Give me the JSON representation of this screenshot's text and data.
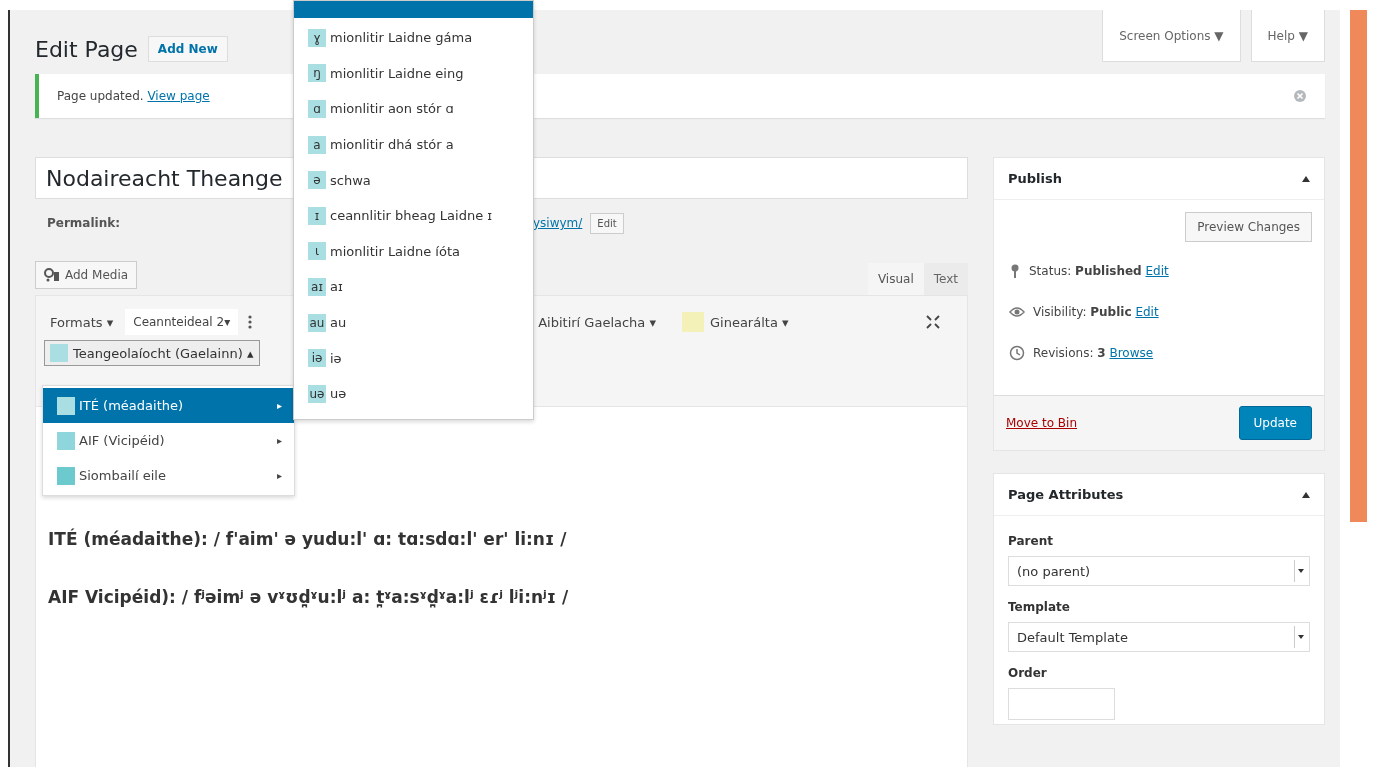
{
  "header": {
    "title": "Edit Page",
    "add_new": "Add New",
    "screen_options": "Screen Options ▼",
    "help": "Help ▼"
  },
  "notice": {
    "text": "Page updated.",
    "link": "View page"
  },
  "post": {
    "title": "Nodaireacht Theange",
    "permalink_label": "Permalink:",
    "permalink_link": "ysiwym/",
    "permalink_edit": "Edit"
  },
  "add_media": "Add Media",
  "editor_tabs": [
    {
      "label": "Visual",
      "selected": true
    },
    {
      "label": "Text",
      "selected": false
    }
  ],
  "toolbar": [
    {
      "kind": "menu",
      "label": "Formats ▾"
    },
    {
      "kind": "select",
      "label": "Ceannteideal 2▾"
    },
    {
      "kind": "more"
    },
    {
      "kind": "menu",
      "label": "Aibitirí Gaelacha ▾"
    },
    {
      "kind": "swatch",
      "label": "Ginearálta ▾",
      "color": "#f4f1b8"
    }
  ],
  "toolbar2": {
    "label": "Teangeolaíocht (Gaelainn) ▴",
    "color": "#a9dfe3"
  },
  "submenu": [
    {
      "label": "ITÉ (méadaithe)",
      "arrow": "▸",
      "selected": true,
      "color": "#a9dfe3"
    },
    {
      "label": "AIF (Vicipéid)",
      "arrow": "▸",
      "selected": false,
      "color": "#8fd6dc"
    },
    {
      "label": "Siombailí eile",
      "arrow": "▸",
      "selected": false,
      "color": "#6ccacf"
    }
  ],
  "symbol_menu": [
    {
      "glyph": "ɣ",
      "label": "mionlitir Laidne gáma"
    },
    {
      "glyph": "ŋ",
      "label": "mionlitir Laidne eing"
    },
    {
      "glyph": "ɑ",
      "label": "mionlitir aon stór ɑ"
    },
    {
      "glyph": "a",
      "label": "mionlitir dhá stór a"
    },
    {
      "glyph": "ə",
      "label": "schwa"
    },
    {
      "glyph": "ɪ",
      "label": "ceannlitir bheag Laidne ɪ"
    },
    {
      "glyph": "ɩ",
      "label": "mionlitir Laidne íóta"
    },
    {
      "glyph": "aɪ",
      "label": "aɪ"
    },
    {
      "glyph": "au",
      "label": "au"
    },
    {
      "glyph": "iə",
      "label": "iə"
    },
    {
      "glyph": "uə",
      "label": "uə"
    }
  ],
  "content": [
    "ITÉ (méadaithe): / f'aim' ə yudu:l' ɑ: tɑ:sdɑ:l' er' li:nɪ /",
    "AIF Vicipéid): / fʲəimʲ ə vˠʊd̪ˠu:lʲ a: t̪ˠa:sˠd̪ˠa:lʲ ɛɾʲ lʲi:nʲɪ /"
  ],
  "publish": {
    "title": "Publish",
    "preview": "Preview Changes",
    "rows": [
      {
        "kind": "status",
        "label": "Status:",
        "value": "Published",
        "link": "Edit"
      },
      {
        "kind": "visibility",
        "label": "Visibility:",
        "value": "Public",
        "link": "Edit"
      },
      {
        "kind": "revisions",
        "label": "Revisions:",
        "value": "3",
        "link": "Browse"
      }
    ],
    "trash": "Move to Bin",
    "update": "Update"
  },
  "attributes": {
    "title": "Page Attributes",
    "fields": [
      {
        "label": "Parent",
        "value": "(no parent)"
      },
      {
        "label": "Template",
        "value": "Default Template"
      }
    ],
    "order_label": "Order"
  }
}
